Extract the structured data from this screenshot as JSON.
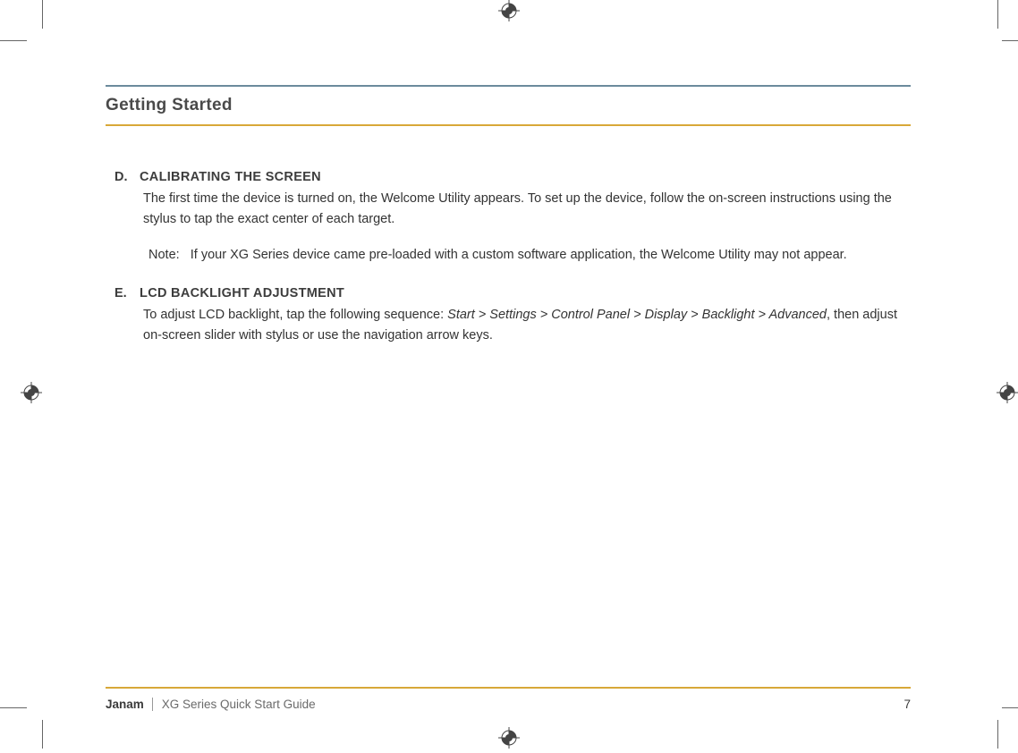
{
  "header": {
    "section_title": "Getting Started"
  },
  "sections": {
    "d": {
      "marker": "D.",
      "heading": "CALIBRATING THE SCREEN",
      "body": "The first time the device is turned on, the Welcome Utility appears.  To set up the device, follow the on-screen instructions using the stylus to tap the exact center of each target.",
      "note_label": "Note:",
      "note_body": "If your XG Series device came pre-loaded with a custom software application, the Welcome Utility may not appear."
    },
    "e": {
      "marker": "E.",
      "heading": "LCD BACKLIGHT ADJUSTMENT",
      "body_pre": "To adjust LCD backlight, tap the following sequence: ",
      "body_italic": "Start > Settings > Control Panel > Display > Backlight > Advanced",
      "body_post": ", then adjust on-screen slider with stylus or use the navigation arrow keys."
    }
  },
  "footer": {
    "brand": "Janam",
    "guide": "XG Series Quick Start Guide",
    "page_number": "7"
  }
}
